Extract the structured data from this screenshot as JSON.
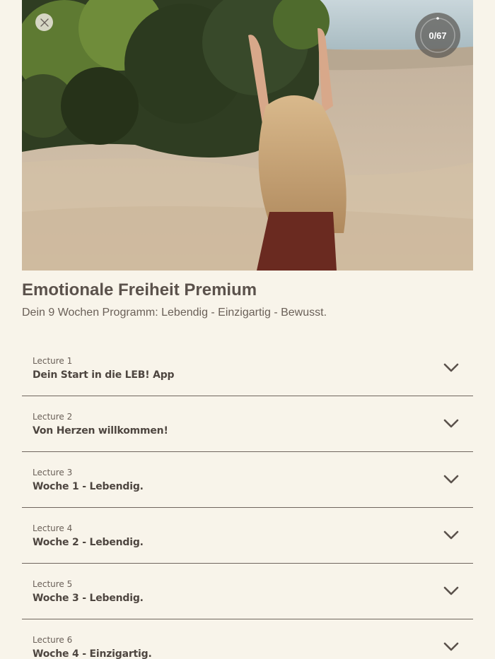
{
  "progress": {
    "label": "0/67",
    "completed": 0,
    "total": 67
  },
  "course": {
    "title": "Emotionale Freiheit Premium",
    "subtitle": "Dein 9 Wochen Programm: Lebendig - Einzigartig - Bewusst."
  },
  "lectures": [
    {
      "number": "Lecture 1",
      "title": "Dein Start in die LEB! App"
    },
    {
      "number": "Lecture 2",
      "title": "Von Herzen willkommen!"
    },
    {
      "number": "Lecture 3",
      "title": "Woche 1 - Lebendig."
    },
    {
      "number": "Lecture 4",
      "title": "Woche 2 - Lebendig."
    },
    {
      "number": "Lecture 5",
      "title": "Woche 3 - Lebendig."
    },
    {
      "number": "Lecture 6",
      "title": "Woche 4 - Einzigartig."
    }
  ],
  "icons": {
    "close": "close-icon",
    "expand": "chevron-down-icon"
  },
  "colors": {
    "background": "#f8f4ea",
    "text": "#5b524c",
    "divider": "#6f655d"
  }
}
